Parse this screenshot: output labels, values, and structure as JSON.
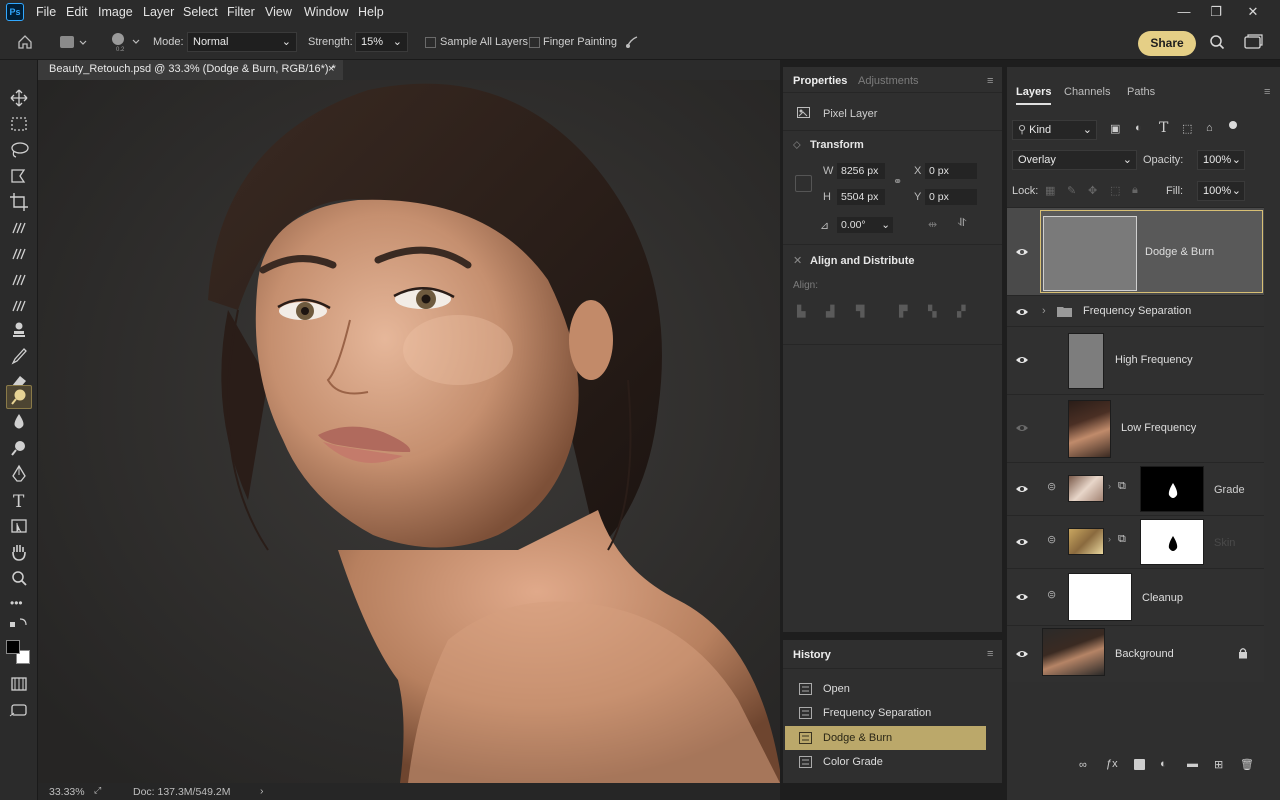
{
  "app": {
    "logo": "Ps",
    "accent": "#e5cf86",
    "selection_color": "#bba86a"
  },
  "menu": [
    "File",
    "Edit",
    "Image",
    "Layer",
    "Select",
    "Filter",
    "View",
    "Window",
    "Help"
  ],
  "window_controls": {
    "minimize": "—",
    "maximize": "❐",
    "close": "✕"
  },
  "options": {
    "mode_label": "Mode:",
    "mode_value": "Normal",
    "strength_label": "Strength:",
    "strength_value": "15%",
    "sample_all_layers": "Sample All Layers",
    "finger_painting": "Finger Painting",
    "share": "Share"
  },
  "document": {
    "tab_title": "Beauty_Retouch.psd @ 33.3% (Dodge & Burn, RGB/16*) *",
    "close": "×",
    "zoom": "33.33%",
    "doc_info": "Doc: 137.3M/549.2M"
  },
  "properties": {
    "tab_properties": "Properties",
    "tab_adjustments": "Adjustments",
    "layer_type": "Pixel Layer",
    "transform_title": "Transform",
    "w_label": "W",
    "w_value": "8256 px",
    "h_label": "H",
    "h_value": "5504 px",
    "x_label": "X",
    "x_value": "0 px",
    "y_label": "Y",
    "y_value": "0 px",
    "angle_value": "0.00°",
    "align_title": "Align and Distribute",
    "align_label": "Align:"
  },
  "history": {
    "title": "History",
    "items": [
      "Open",
      "Frequency Separation",
      "Dodge & Burn",
      "Color Grade"
    ],
    "selected_index": 2
  },
  "layers_panel": {
    "tabs": [
      "Layers",
      "Channels",
      "Paths"
    ],
    "kind_label": "Kind",
    "blend_mode": "Overlay",
    "opacity_label": "Opacity:",
    "opacity_value": "100%",
    "lock_label": "Lock:",
    "fill_label": "Fill:",
    "fill_value": "100%",
    "layers": [
      {
        "name": "Dodge & Burn",
        "visible": true,
        "selected": true
      },
      {
        "name": "Frequency Separation",
        "visible": true,
        "group": true
      },
      {
        "name": "High Frequency",
        "visible": true
      },
      {
        "name": "Low Frequency",
        "visible": false
      },
      {
        "name": "Grade",
        "visible": true
      },
      {
        "name": "Skin",
        "visible": true
      },
      {
        "name": "Cleanup",
        "visible": true
      },
      {
        "name": "Background",
        "visible": true,
        "locked": true
      }
    ]
  }
}
